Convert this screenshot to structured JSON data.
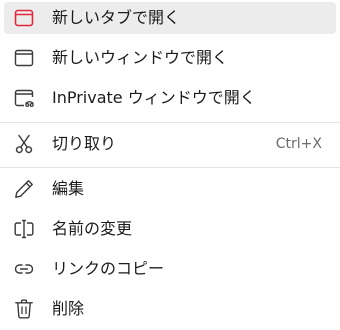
{
  "colors": {
    "accent": "#e0283c",
    "text": "#1b1b1b",
    "shortcut": "#6b6b6b",
    "highlight": "#ececec",
    "separator": "#e3e3e3",
    "icon": "#3a3a3a"
  },
  "menu": {
    "items": [
      {
        "label": "新しいタブで開く",
        "icon": "new-tab-icon",
        "highlighted": true
      },
      {
        "label": "新しいウィンドウで開く",
        "icon": "new-window-icon"
      },
      {
        "label": "InPrivate ウィンドウで開く",
        "icon": "inprivate-window-icon"
      },
      {
        "label": "切り取り",
        "icon": "scissors-icon",
        "shortcut": "Ctrl+X"
      },
      {
        "label": "編集",
        "icon": "pencil-icon"
      },
      {
        "label": "名前の変更",
        "icon": "rename-icon"
      },
      {
        "label": "リンクのコピー",
        "icon": "link-icon"
      },
      {
        "label": "削除",
        "icon": "trash-icon"
      }
    ]
  }
}
